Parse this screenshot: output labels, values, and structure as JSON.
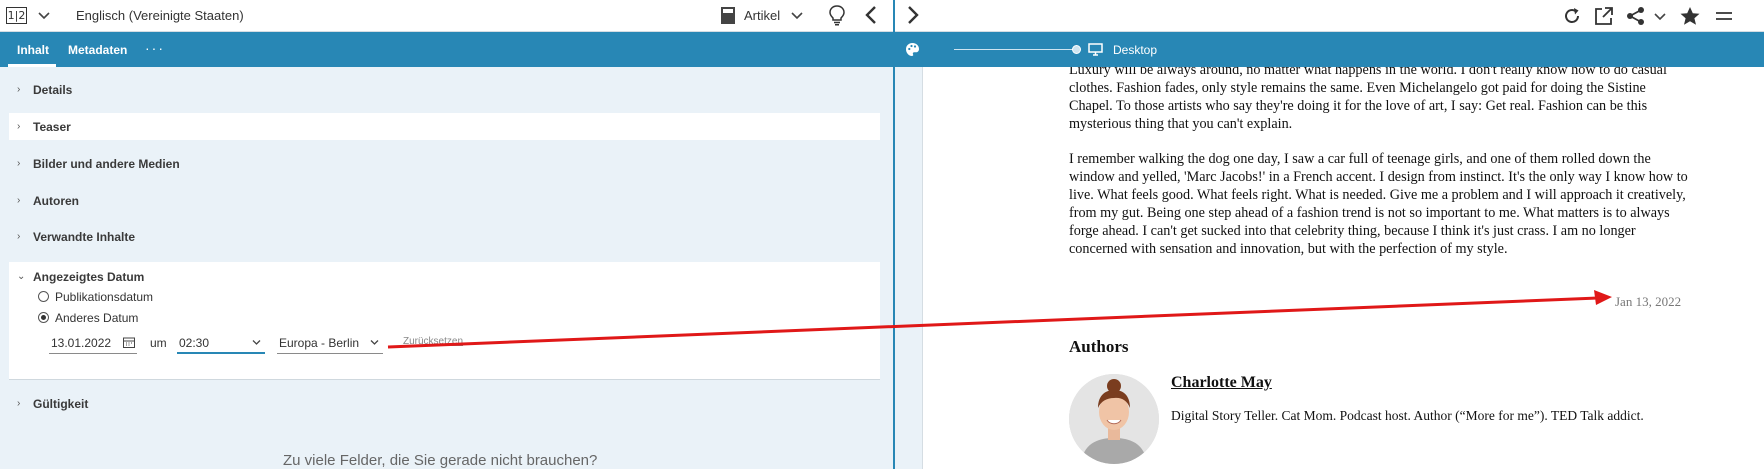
{
  "editor": {
    "language_icon": "1|2",
    "language": "Englisch (Vereinigte Staaten)",
    "doc_type": "Artikel",
    "tabs": [
      {
        "label": "Inhalt",
        "active": true
      },
      {
        "label": "Metadaten",
        "active": false
      }
    ],
    "tabs_more": "···",
    "sections": {
      "details": "Details",
      "teaser": "Teaser",
      "media": "Bilder und andere Medien",
      "authors": "Autoren",
      "related": "Verwandte Inhalte",
      "displayed_date": "Angezeigtes Datum",
      "validity": "Gültigkeit"
    },
    "date_options": {
      "publication": "Publikationsdatum",
      "other": "Anderes Datum",
      "selected": "other"
    },
    "date_value": "13.01.2022",
    "at_label": "um",
    "time_value": "02:30",
    "timezone": "Europa - Berlin",
    "reset_label": "Zurücksetzen",
    "bottom_hint": "Zu viele Felder, die Sie gerade nicht brauchen?"
  },
  "preview": {
    "device_label": "Desktop",
    "paragraph1": "Luxury will be always around, no matter what happens in the world. I don't really know how to do casual clothes. Fashion fades, only style remains the same. Even Michelangelo got paid for doing the Sistine Chapel. To those artists who say they're doing it for the love of art, I say: Get real. Fashion can be this mysterious thing that you can't explain.",
    "paragraph2": "I remember walking the dog one day, I saw a car full of teenage girls, and one of them rolled down the window and yelled, 'Marc Jacobs!' in a French accent. I design from instinct. It's the only way I know how to live. What feels good. What feels right. What is needed. Give me a problem and I will approach it creatively, from my gut. Being one step ahead of a fashion trend is not so important to me. What matters is to always forge ahead. I can't get sucked into that celebrity thing, because I think it's just crass. I am no longer concerned with sensation and innovation, but with the perfection of my style.",
    "date": "Jan 13, 2022",
    "authors_heading": "Authors",
    "author_name": "Charlotte May",
    "author_bio": "Digital Story Teller. Cat Mom. Podcast host. Author (“More for me”). TED Talk addict."
  },
  "icons": {
    "language": "language-switch-icon",
    "chevron": "chevron-down-icon",
    "article": "article-icon",
    "tips": "lightbulb-icon",
    "collapse": "chevron-left-icon",
    "expand": "chevron-right-icon",
    "reload": "reload-icon",
    "open_external": "external-link-icon",
    "share": "share-icon",
    "bookmark": "star-icon",
    "palette": "palette-icon",
    "device": "monitor-icon",
    "calendar": "calendar-icon",
    "annotation": "red-arrow-annotation"
  },
  "colors": {
    "accent": "#2887b5",
    "panel_bg": "#eaf2f8",
    "annotation": "#e01818"
  }
}
